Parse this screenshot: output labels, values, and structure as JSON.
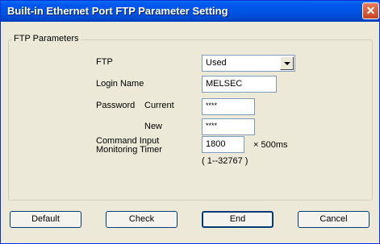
{
  "window": {
    "title": "Built-in Ethernet Port FTP Parameter Setting"
  },
  "icons": {
    "close": "close-icon",
    "dropdown": "chevron-down-icon"
  },
  "group": {
    "label": "FTP Parameters"
  },
  "ftp": {
    "label": "FTP",
    "value": "Used"
  },
  "login": {
    "label": "Login Name",
    "value": "MELSEC"
  },
  "password": {
    "label": "Password",
    "current_label": "Current",
    "current_value": "****",
    "new_label": "New",
    "new_value": "****"
  },
  "timer": {
    "label_line1": "Command Input",
    "label_line2": "Monitoring Timer",
    "value": "1800",
    "unit": "× 500ms",
    "range": "( 1--32767 )"
  },
  "buttons": {
    "default": "Default",
    "check": "Check",
    "end": "End",
    "cancel": "Cancel"
  },
  "colors": {
    "title_bar": "#0054e3",
    "close_button": "#d9532c",
    "dialog_bg": "#ece9d8"
  }
}
